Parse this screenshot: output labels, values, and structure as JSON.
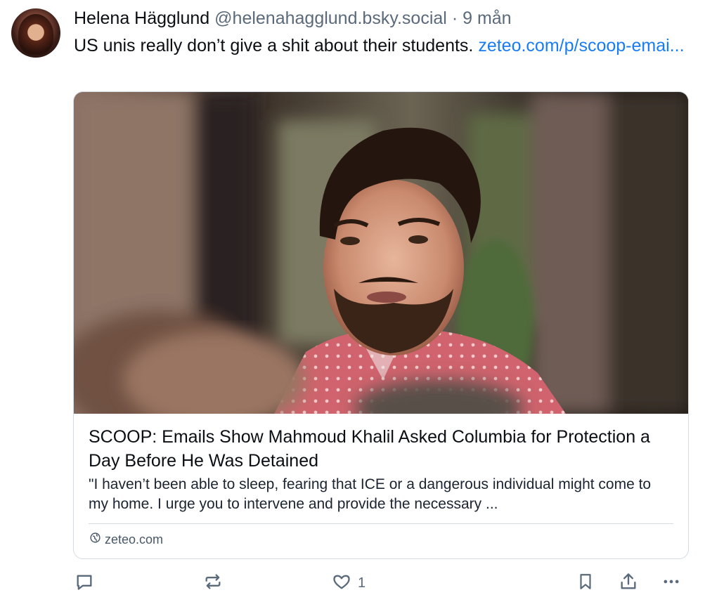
{
  "post": {
    "author": {
      "display_name": "Helena Hägglund",
      "handle": "@helenahagglund.bsky.social",
      "separator": "·",
      "time": "9 mån"
    },
    "text": "US unis really don’t give a shit about their students.",
    "link_text": "zeteo.com/p/scoop-emai..."
  },
  "embed": {
    "title": "SCOOP: Emails Show Mahmoud Khalil Asked Columbia for Protection a Day Before He Was Detained",
    "description": "\"I haven’t been able to sleep, fearing that ICE or a dangerous individual might come to my home. I urge you to intervene and provide the necessary ...",
    "domain": "zeteo.com"
  },
  "actions": {
    "reply_icon": "speech-bubble-icon",
    "repost_icon": "repost-icon",
    "like_icon": "heart-icon",
    "like_count": "1",
    "bookmark_icon": "bookmark-icon",
    "share_icon": "share-icon",
    "more_icon": "ellipsis-icon"
  },
  "colors": {
    "link": "#1a7cf5",
    "muted": "#5b6a7b",
    "border": "#d4dbe2"
  }
}
